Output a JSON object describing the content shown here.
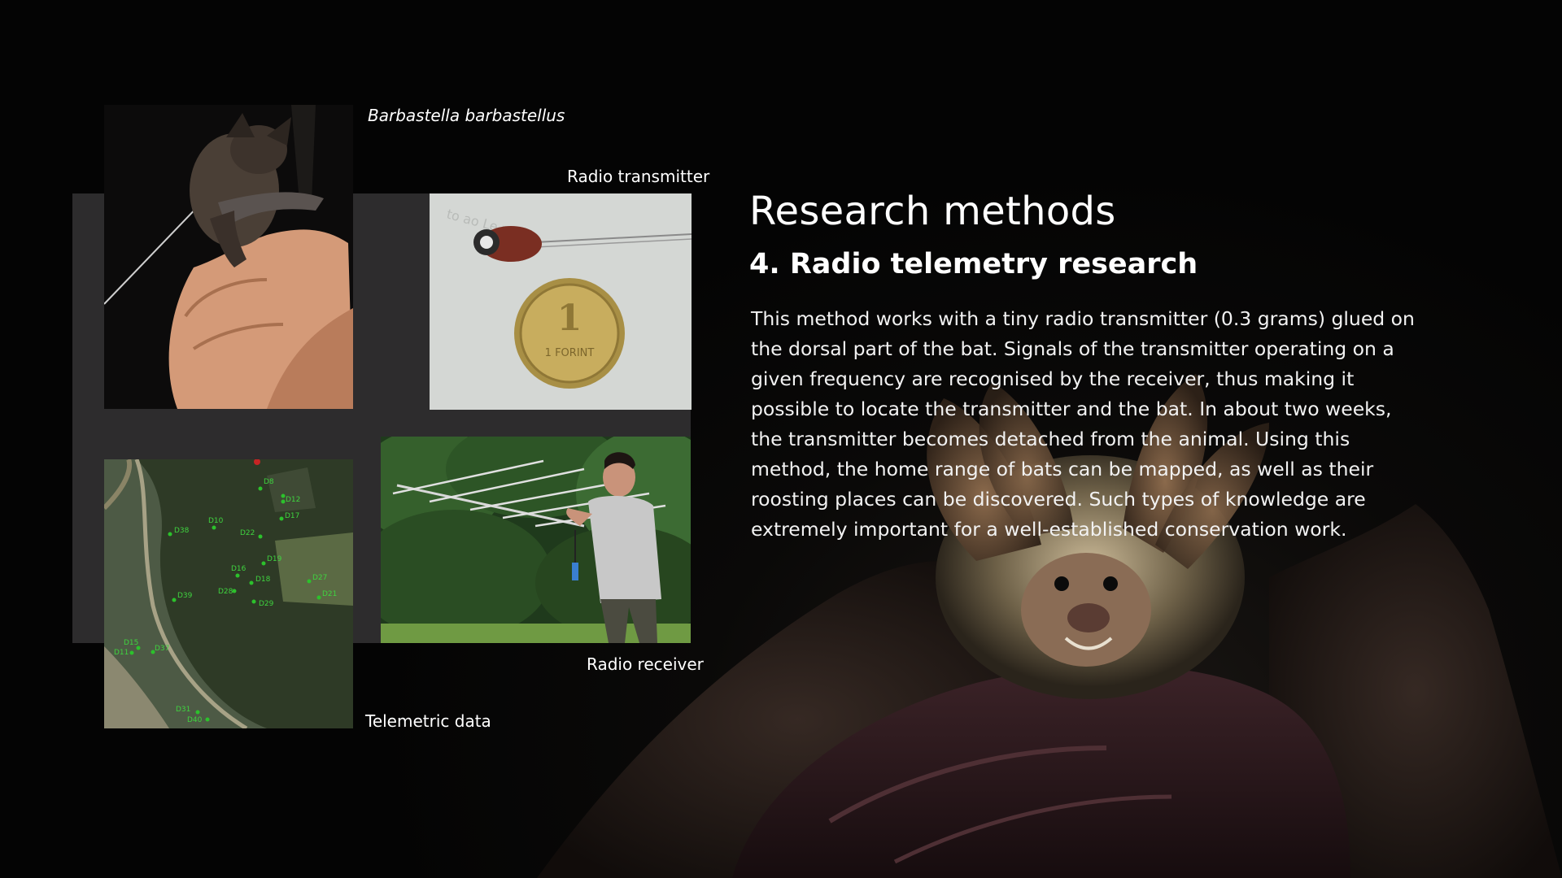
{
  "slide": {
    "title": "Research methods",
    "subtitle": "4. Radio telemetry research",
    "body": "This method works with a tiny radio transmitter (0.3 grams) glued on the dorsal part of the bat. Signals of the transmitter operating on a given frequency are recognised by the receiver, thus making it possible to locate the transmitter and the bat. In about two weeks, the transmitter becomes detached from the animal. Using this method, the home range of bats can be mapped, as well as their roosting places can be discovered. Such types of knowledge are extremely important for a well-established conservation work."
  },
  "photos": {
    "bat_in_hand": {
      "caption": "Barbastella barbastellus"
    },
    "transmitter": {
      "caption": "Radio transmitter",
      "coin_text": "1 FORINT"
    },
    "receiver": {
      "caption": "Radio receiver"
    },
    "map": {
      "caption": "Telemetric data",
      "points": [
        "D38",
        "D10",
        "D22",
        "D8",
        "D12",
        "D17",
        "D19",
        "D16",
        "D18",
        "D27",
        "D28",
        "D29",
        "D21",
        "D39",
        "D15",
        "D11",
        "D37",
        "D31",
        "D40"
      ]
    }
  },
  "colors": {
    "background": "#040404",
    "panel": "#2d2c2d",
    "text": "#ffffff",
    "map_point": "#2cc12c"
  }
}
